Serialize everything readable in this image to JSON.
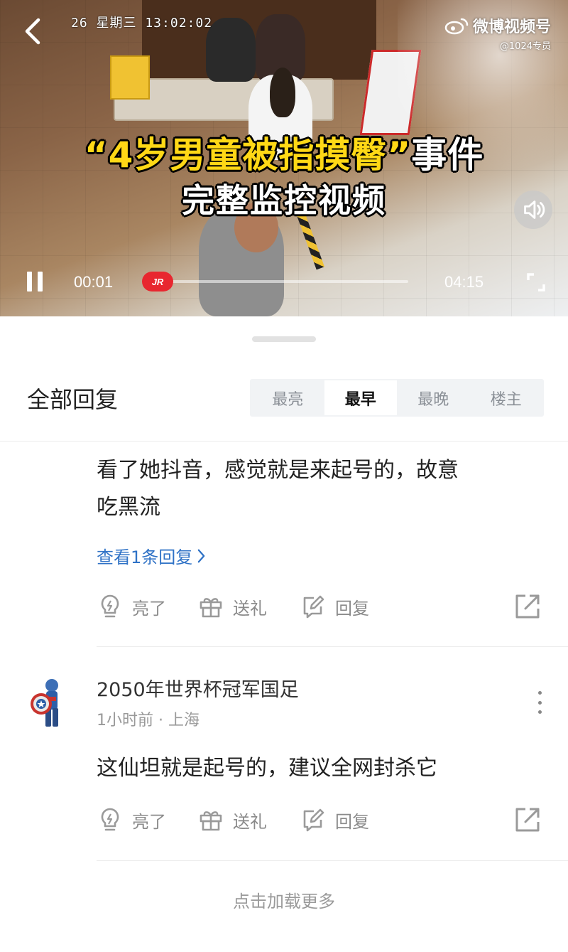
{
  "video": {
    "timestamp": "26 星期三 13:02:02",
    "watermark_title": "微博视频号",
    "watermark_handle": "@1024专员",
    "headline_line1_quote_open": "“",
    "headline_line1_main": "4岁男童被指摸臀",
    "headline_line1_quote_close": "”",
    "headline_line1_tail": "事件",
    "headline_line2": "完整监控视频",
    "current_time": "00:01",
    "total_time": "04:15",
    "progress_fraction": 0.004,
    "thumb_label": "JR",
    "accent_color": "#e8272f"
  },
  "replies": {
    "title": "全部回复",
    "sort_tabs": [
      "最亮",
      "最早",
      "最晚",
      "楼主"
    ],
    "active_tab": "最早"
  },
  "comments": [
    {
      "text_line1": "看了她抖音，感觉就是来起号的，故意",
      "text_line2": "吃黑流",
      "view_replies": "查看1条回复",
      "actions": {
        "like": "亮了",
        "gift": "送礼",
        "reply": "回复"
      }
    },
    {
      "username": "2050年世界杯冠军国足",
      "time": "1小时前",
      "separator": "·",
      "location": "上海",
      "text_line1": "这仙坦就是起号的，建议全网封杀它",
      "actions": {
        "like": "亮了",
        "gift": "送礼",
        "reply": "回复"
      }
    }
  ],
  "load_more": "点击加载更多",
  "icons": [
    "back-icon",
    "weibo-logo-icon",
    "volume-icon",
    "pause-icon",
    "fullscreen-icon",
    "lightbulb-icon",
    "gift-icon",
    "edit-icon",
    "share-icon",
    "chevron-right-icon",
    "more-vertical-icon"
  ]
}
